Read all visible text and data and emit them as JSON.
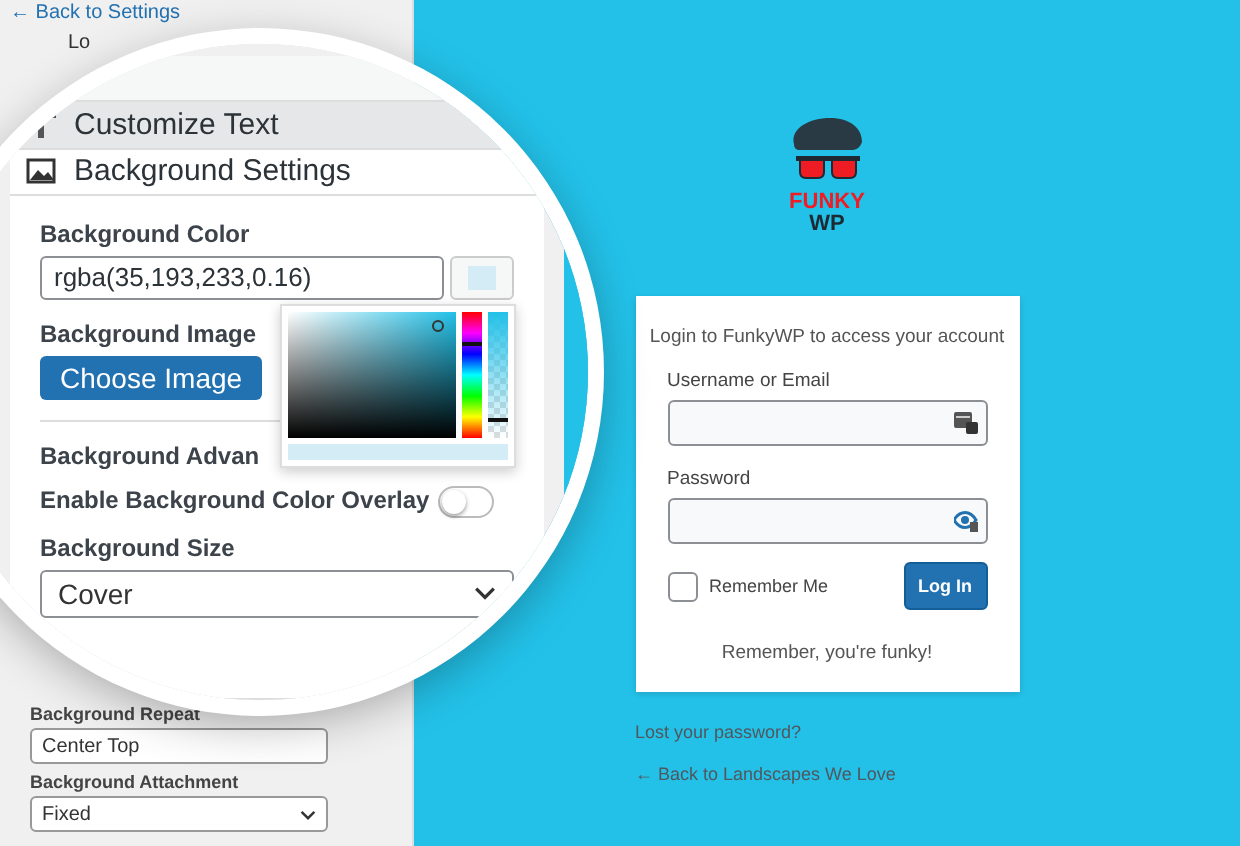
{
  "sidebar": {
    "back_link": "← Back to Settings",
    "partial_item": "Lo",
    "sections": [
      {
        "title": "Customize Text",
        "expanded": false
      },
      {
        "title": "Background Settings",
        "expanded": true
      }
    ],
    "background_color": {
      "label": "Background Color",
      "value": "rgba(35,193,233,0.16)",
      "hue_slider": {
        "level": 0.76
      },
      "opacity_slider": {
        "level": 0.16
      }
    },
    "background_image": {
      "label": "Background Image",
      "button": "Choose Image"
    },
    "advanced_heading": "Background Advan",
    "overlay": {
      "label": "Enable Background Color Overlay",
      "on": false
    },
    "size": {
      "label": "Background Size",
      "value": "Cover"
    },
    "repeat": {
      "label": "Background Repeat",
      "value": "Center Top"
    },
    "attachment": {
      "label": "Background Attachment",
      "value": "Fixed"
    }
  },
  "login": {
    "logo_top": "FUNKY",
    "logo_bottom": "WP",
    "intro": "Login to FunkyWP to access your account",
    "username_label": "Username or Email",
    "password_label": "Password",
    "remember": {
      "label": "Remember Me",
      "checked": false
    },
    "button": "Log In",
    "tagline": "Remember, you're funky!",
    "lost_password": "Lost your password?",
    "back_link": "← Back to Landscapes We Love"
  }
}
